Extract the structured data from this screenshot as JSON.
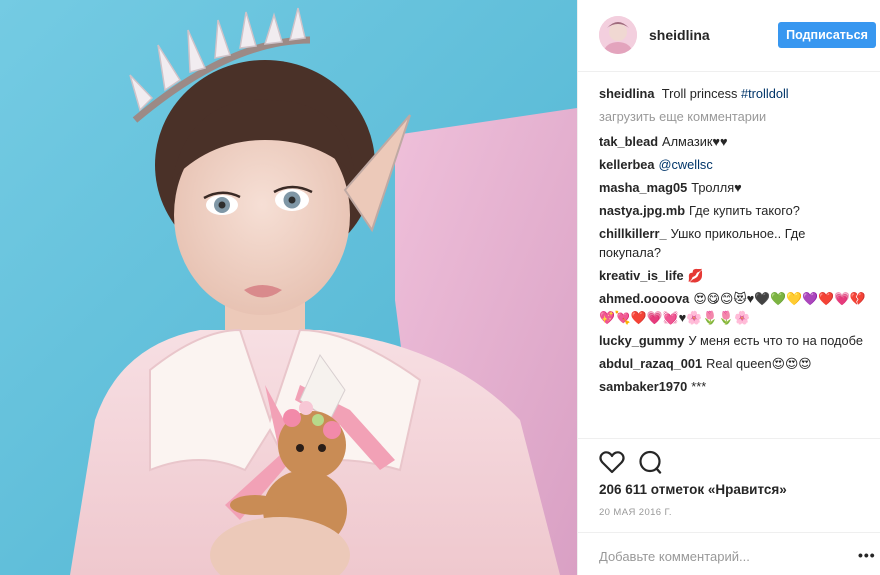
{
  "post": {
    "username": "sheidlina",
    "follow_label": "Подписаться",
    "caption_user": "sheidlina",
    "caption_text": "Troll princess",
    "caption_tag": "#trolldoll",
    "load_more": "загрузить еще комментарии",
    "comments": [
      {
        "user": "tak_blead",
        "text": "Алмазик♥♥"
      },
      {
        "user": "kellerbea",
        "text": "@cwellsc"
      },
      {
        "user": "masha_mag05",
        "text": "Тролля♥"
      },
      {
        "user": "nastya.jpg.mb",
        "text": "Где купить такого?"
      },
      {
        "user": "chillkillerr_",
        "text": "Ушко прикольное.. Где покупала?"
      },
      {
        "user": "kreativ_is_life",
        "text": "💋"
      },
      {
        "user": "ahmed.oooova",
        "text": "😍😋😊😻♥🖤💚💛💜❤️💗💔💖💘❤️💗💓♥🌸🌷🌷🌸"
      },
      {
        "user": "lucky_gummy",
        "text": "У меня есть что то на подобе"
      },
      {
        "user": "abdul_razaq_001",
        "text": "Real queen😍😍😍"
      },
      {
        "user": "sambaker1970",
        "text": "***"
      }
    ],
    "likes": "206 611 отметок «Нравится»",
    "date": "20 МАЯ 2016 Г.",
    "comment_placeholder": "Добавьте комментарий...",
    "more_label": "•••"
  },
  "icons": {
    "like": "heart-icon",
    "comment": "comment-icon"
  },
  "colors": {
    "follow_button": "#3897f0",
    "wall_blue": "#63c3de",
    "wall_pink": "#e8b3d2",
    "muted_text": "#999999"
  }
}
